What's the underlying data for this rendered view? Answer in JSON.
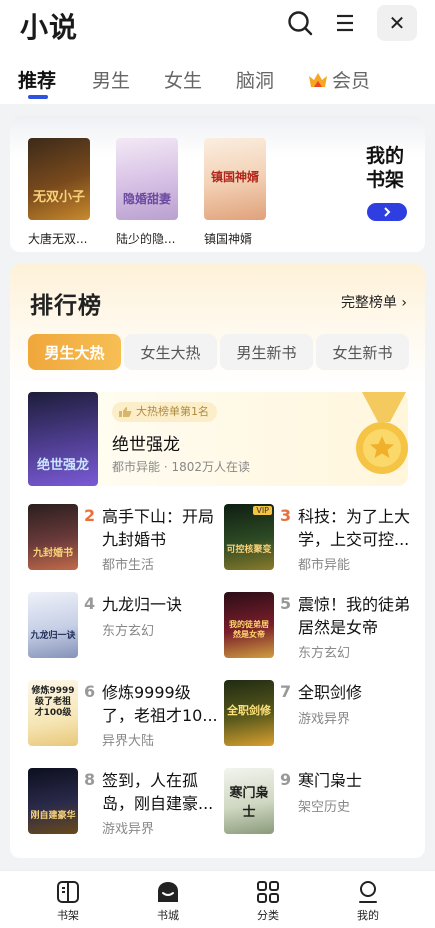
{
  "app": {
    "title": "小说"
  },
  "tabs": [
    {
      "label": "推荐",
      "active": true
    },
    {
      "label": "男生"
    },
    {
      "label": "女生"
    },
    {
      "label": "脑洞"
    },
    {
      "label": "会员",
      "icon": "crown-icon"
    }
  ],
  "shelf": {
    "books": [
      {
        "name": "大唐无双...",
        "cover_text": "无双小子"
      },
      {
        "name": "陆少的隐...",
        "cover_text": "隐婚甜妻"
      },
      {
        "name": "镇国神婿",
        "cover_text": "镇国神婿"
      }
    ],
    "my_shelf_title": "我的书架"
  },
  "ranking": {
    "title": "排行榜",
    "full_list": "完整榜单",
    "segments": [
      {
        "label": "男生大热",
        "active": true
      },
      {
        "label": "女生大热"
      },
      {
        "label": "男生新书"
      },
      {
        "label": "女生新书"
      }
    ],
    "top1": {
      "badge": "大热榜单第1名",
      "title": "绝世强龙",
      "meta": "都市异能 · 1802万人在读",
      "cover_text": "绝世强龙"
    },
    "items": [
      {
        "rank": "2",
        "title": "高手下山：开局九封婚书",
        "category": "都市生活",
        "cover_text": "九封婚书"
      },
      {
        "rank": "3",
        "title": "科技：为了上大学，上交可控...",
        "category": "都市异能",
        "cover_text": "可控核聚变",
        "vip": "VIP"
      },
      {
        "rank": "4",
        "title": "九龙归一诀",
        "category": "东方玄幻",
        "cover_text": "九龙归一诀"
      },
      {
        "rank": "5",
        "title": "震惊！我的徒弟居然是女帝",
        "category": "东方玄幻",
        "cover_text": "我的徒弟居然是女帝"
      },
      {
        "rank": "6",
        "title": "修炼9999级了，老祖才10...",
        "category": "异界大陆",
        "cover_text": "修炼9999级了老祖才100级"
      },
      {
        "rank": "7",
        "title": "全职剑修",
        "category": "游戏异界",
        "cover_text": "全职剑修"
      },
      {
        "rank": "8",
        "title": "签到，人在孤岛，刚自建豪...",
        "category": "游戏异界",
        "cover_text": "刚自建豪华"
      },
      {
        "rank": "9",
        "title": "寒门枭士",
        "category": "架空历史",
        "cover_text": "寒门枭士"
      }
    ]
  },
  "bottom_nav": [
    {
      "label": "书架",
      "icon": "bookshelf-icon"
    },
    {
      "label": "书城",
      "icon": "bookstore-icon",
      "active": true
    },
    {
      "label": "分类",
      "icon": "category-icon"
    },
    {
      "label": "我的",
      "icon": "profile-icon"
    }
  ],
  "colors": {
    "accent": "#2f52e0",
    "rank_orange": "#f0a73b",
    "rank_num_top": "#e8713b",
    "rank_num": "#999999"
  }
}
